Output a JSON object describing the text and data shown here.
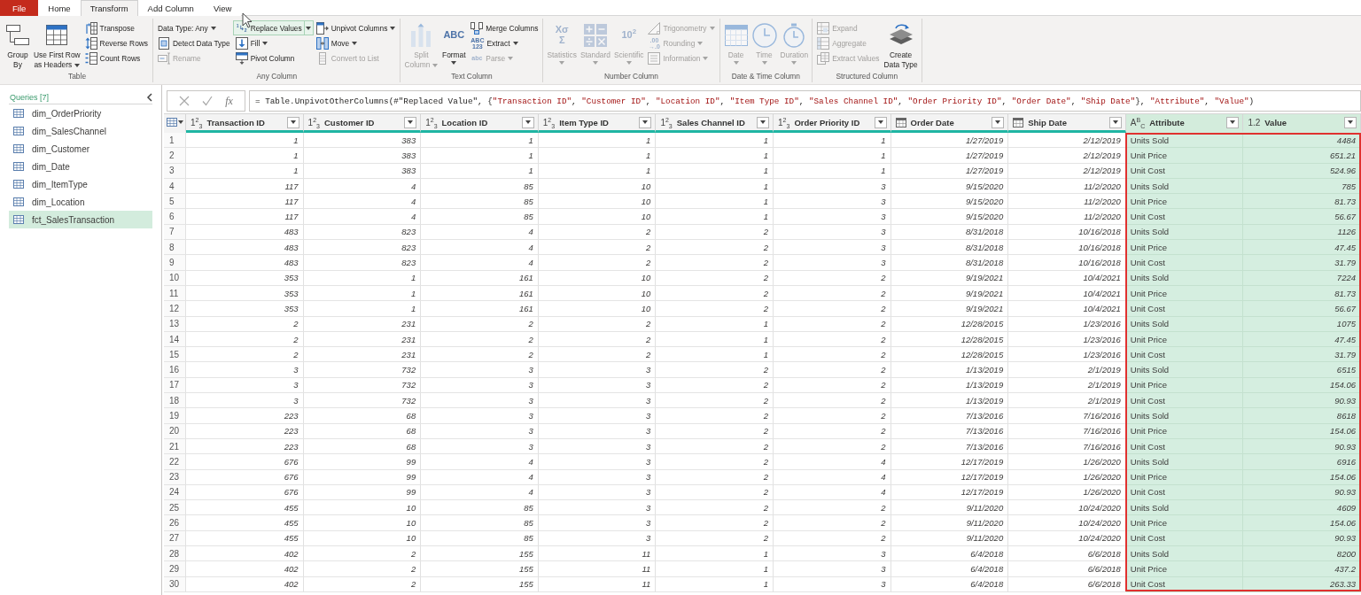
{
  "app_tabs": [
    {
      "label": "File",
      "kind": "file",
      "selected": false
    },
    {
      "label": "Home",
      "kind": "tab",
      "selected": false
    },
    {
      "label": "Transform",
      "kind": "tab",
      "selected": true
    },
    {
      "label": "Add Column",
      "kind": "tab",
      "selected": false
    },
    {
      "label": "View",
      "kind": "tab",
      "selected": false
    }
  ],
  "ribbon_groups": [
    {
      "label": "Table",
      "columns": [
        {
          "kind": "large",
          "items": [
            {
              "label": "Group\nBy",
              "disabled": false
            }
          ]
        },
        {
          "kind": "large",
          "items": [
            {
              "label": "Use First Row\nas Headers",
              "disabled": false,
              "dropdown": true
            }
          ]
        },
        {
          "kind": "small",
          "items": [
            {
              "label": "Transpose",
              "disabled": false
            },
            {
              "label": "Reverse Rows",
              "disabled": false
            },
            {
              "label": "Count Rows",
              "disabled": false
            }
          ]
        }
      ]
    },
    {
      "label": "Any Column",
      "columns": [
        {
          "kind": "small",
          "items": [
            {
              "label": "Data Type: Any",
              "disabled": false,
              "dropdown": true
            },
            {
              "label": "Detect Data Type",
              "disabled": false
            },
            {
              "label": "Rename",
              "disabled": true
            }
          ]
        },
        {
          "kind": "small",
          "items": [
            {
              "label": "Replace Values",
              "glyph": "$^{1}$↳$_{2}$",
              "disabled": false,
              "highlighted": true,
              "dropdown": true,
              "split": true
            },
            {
              "label": "Fill",
              "disabled": false,
              "dropdown": true
            },
            {
              "label": "Pivot Column",
              "disabled": false
            }
          ]
        },
        {
          "kind": "small",
          "items": [
            {
              "label": "Unpivot Columns",
              "disabled": false,
              "dropdown": true
            },
            {
              "label": "Move",
              "disabled": false,
              "dropdown": true
            },
            {
              "label": "Convert to List",
              "disabled": true
            }
          ]
        }
      ]
    },
    {
      "label": "Text Column",
      "columns": [
        {
          "kind": "large",
          "items": [
            {
              "label": "Split\nColumn",
              "disabled": true,
              "dropdown": true
            }
          ]
        },
        {
          "kind": "large",
          "items": [
            {
              "label": "Format",
              "glyph": "ABC",
              "disabled": false,
              "dropdown": true,
              "caret_below": true
            }
          ]
        },
        {
          "kind": "small",
          "items": [
            {
              "label": "Merge Columns",
              "disabled": false
            },
            {
              "label": "Extract",
              "glyph": "ABC\n123",
              "disabled": false,
              "dropdown": true
            },
            {
              "label": "Parse",
              "glyph": "abc",
              "disabled": true,
              "dropdown": true
            }
          ]
        }
      ]
    },
    {
      "label": "Number Column",
      "columns": [
        {
          "kind": "large",
          "items": [
            {
              "label": "Statistics",
              "glyph": "Xσ\nΣ",
              "disabled": true,
              "dropdown": true,
              "caret_below": true
            }
          ]
        },
        {
          "kind": "large",
          "items": [
            {
              "label": "Standard",
              "disabled": true,
              "dropdown": true,
              "caret_below": true
            }
          ]
        },
        {
          "kind": "large",
          "items": [
            {
              "label": "Scientific",
              "glyph": "10$^{2}$",
              "disabled": true,
              "dropdown": true,
              "caret_below": true
            }
          ]
        },
        {
          "kind": "small",
          "items": [
            {
              "label": "Trigonometry",
              "disabled": true,
              "dropdown": true
            },
            {
              "label": "Rounding",
              "glyph": ".00\n→.0",
              "disabled": true,
              "dropdown": true
            },
            {
              "label": "Information",
              "disabled": true,
              "dropdown": true
            }
          ]
        }
      ]
    },
    {
      "label": "Date & Time Column",
      "columns": [
        {
          "kind": "large",
          "items": [
            {
              "label": "Date",
              "disabled": true,
              "dropdown": true,
              "caret_below": true
            }
          ]
        },
        {
          "kind": "large",
          "items": [
            {
              "label": "Time",
              "disabled": true,
              "dropdown": true,
              "caret_below": true
            }
          ]
        },
        {
          "kind": "large",
          "items": [
            {
              "label": "Duration",
              "disabled": true,
              "dropdown": true,
              "caret_below": true
            }
          ]
        }
      ]
    },
    {
      "label": "Structured Column",
      "columns": [
        {
          "kind": "small",
          "items": [
            {
              "label": "Expand",
              "disabled": true
            },
            {
              "label": "Aggregate",
              "disabled": true
            },
            {
              "label": "Extract Values",
              "disabled": true
            }
          ]
        },
        {
          "kind": "large",
          "items": [
            {
              "label": "Create\nData Type",
              "disabled": false
            }
          ]
        }
      ]
    }
  ],
  "sidebar": {
    "title": "Queries [7]",
    "items": [
      {
        "label": "dim_OrderPriority",
        "selected": false
      },
      {
        "label": "dim_SalesChannel",
        "selected": false
      },
      {
        "label": "dim_Customer",
        "selected": false
      },
      {
        "label": "dim_Date",
        "selected": false
      },
      {
        "label": "dim_ItemType",
        "selected": false
      },
      {
        "label": "dim_Location",
        "selected": false
      },
      {
        "label": "fct_SalesTransaction",
        "selected": true
      }
    ]
  },
  "formula_bar": {
    "function_label": "fx",
    "segments": [
      {
        "kind": "code",
        "text": "= Table.UnpivotOtherColumns(#\"Replaced Value\", {"
      },
      {
        "kind": "string",
        "text": "\"Transaction ID\""
      },
      {
        "kind": "code",
        "text": ", "
      },
      {
        "kind": "string",
        "text": "\"Customer ID\""
      },
      {
        "kind": "code",
        "text": ", "
      },
      {
        "kind": "string",
        "text": "\"Location ID\""
      },
      {
        "kind": "code",
        "text": ", "
      },
      {
        "kind": "string",
        "text": "\"Item Type ID\""
      },
      {
        "kind": "code",
        "text": ", "
      },
      {
        "kind": "string",
        "text": "\"Sales Channel ID\""
      },
      {
        "kind": "code",
        "text": ", "
      },
      {
        "kind": "string",
        "text": "\"Order Priority ID\""
      },
      {
        "kind": "code",
        "text": ", "
      },
      {
        "kind": "string",
        "text": "\"Order Date\""
      },
      {
        "kind": "code",
        "text": ", "
      },
      {
        "kind": "string",
        "text": "\"Ship Date\""
      },
      {
        "kind": "code",
        "text": "}, "
      },
      {
        "kind": "string",
        "text": "\"Attribute\""
      },
      {
        "kind": "code",
        "text": ", "
      },
      {
        "kind": "string",
        "text": "\"Value\""
      },
      {
        "kind": "code",
        "text": ")"
      }
    ]
  },
  "table": {
    "columns": [
      {
        "label": "Transaction ID",
        "kind": "number",
        "type_glyph": "1$^{2}$$_{3}$",
        "selected": false,
        "outlined": false
      },
      {
        "label": "Customer ID",
        "kind": "number",
        "type_glyph": "1$^{2}$$_{3}$",
        "selected": false,
        "outlined": false
      },
      {
        "label": "Location ID",
        "kind": "number",
        "type_glyph": "1$^{2}$$_{3}$",
        "selected": false,
        "outlined": false
      },
      {
        "label": "Item Type ID",
        "kind": "number",
        "type_glyph": "1$^{2}$$_{3}$",
        "selected": false,
        "outlined": false
      },
      {
        "label": "Sales Channel ID",
        "kind": "number",
        "type_glyph": "1$^{2}$$_{3}$",
        "selected": false,
        "outlined": false
      },
      {
        "label": "Order Priority ID",
        "kind": "number",
        "type_glyph": "1$^{2}$$_{3}$",
        "selected": false,
        "outlined": false
      },
      {
        "label": "Order Date",
        "kind": "date",
        "selected": false,
        "outlined": false
      },
      {
        "label": "Ship Date",
        "kind": "date",
        "selected": false,
        "outlined": false
      },
      {
        "label": "Attribute",
        "kind": "text",
        "type_glyph": "A$^{B}$$_{C}$",
        "selected": true,
        "outlined": true
      },
      {
        "label": "Value",
        "kind": "decimal",
        "type_glyph": "1.2",
        "selected": true,
        "outlined": true
      }
    ],
    "rows": [
      {
        "number": "1",
        "cells": [
          "1",
          "383",
          "1",
          "1",
          "1",
          "1",
          "1/27/2019",
          "2/12/2019",
          "Units Sold",
          "4484"
        ]
      },
      {
        "number": "2",
        "cells": [
          "1",
          "383",
          "1",
          "1",
          "1",
          "1",
          "1/27/2019",
          "2/12/2019",
          "Unit Price",
          "651.21"
        ]
      },
      {
        "number": "3",
        "cells": [
          "1",
          "383",
          "1",
          "1",
          "1",
          "1",
          "1/27/2019",
          "2/12/2019",
          "Unit Cost",
          "524.96"
        ]
      },
      {
        "number": "4",
        "cells": [
          "117",
          "4",
          "85",
          "10",
          "1",
          "3",
          "9/15/2020",
          "11/2/2020",
          "Units Sold",
          "785"
        ]
      },
      {
        "number": "5",
        "cells": [
          "117",
          "4",
          "85",
          "10",
          "1",
          "3",
          "9/15/2020",
          "11/2/2020",
          "Unit Price",
          "81.73"
        ]
      },
      {
        "number": "6",
        "cells": [
          "117",
          "4",
          "85",
          "10",
          "1",
          "3",
          "9/15/2020",
          "11/2/2020",
          "Unit Cost",
          "56.67"
        ]
      },
      {
        "number": "7",
        "cells": [
          "483",
          "823",
          "4",
          "2",
          "2",
          "3",
          "8/31/2018",
          "10/16/2018",
          "Units Sold",
          "1126"
        ]
      },
      {
        "number": "8",
        "cells": [
          "483",
          "823",
          "4",
          "2",
          "2",
          "3",
          "8/31/2018",
          "10/16/2018",
          "Unit Price",
          "47.45"
        ]
      },
      {
        "number": "9",
        "cells": [
          "483",
          "823",
          "4",
          "2",
          "2",
          "3",
          "8/31/2018",
          "10/16/2018",
          "Unit Cost",
          "31.79"
        ]
      },
      {
        "number": "10",
        "cells": [
          "353",
          "1",
          "161",
          "10",
          "2",
          "2",
          "9/19/2021",
          "10/4/2021",
          "Units Sold",
          "7224"
        ]
      },
      {
        "number": "11",
        "cells": [
          "353",
          "1",
          "161",
          "10",
          "2",
          "2",
          "9/19/2021",
          "10/4/2021",
          "Unit Price",
          "81.73"
        ]
      },
      {
        "number": "12",
        "cells": [
          "353",
          "1",
          "161",
          "10",
          "2",
          "2",
          "9/19/2021",
          "10/4/2021",
          "Unit Cost",
          "56.67"
        ]
      },
      {
        "number": "13",
        "cells": [
          "2",
          "231",
          "2",
          "2",
          "1",
          "2",
          "12/28/2015",
          "1/23/2016",
          "Units Sold",
          "1075"
        ]
      },
      {
        "number": "14",
        "cells": [
          "2",
          "231",
          "2",
          "2",
          "1",
          "2",
          "12/28/2015",
          "1/23/2016",
          "Unit Price",
          "47.45"
        ]
      },
      {
        "number": "15",
        "cells": [
          "2",
          "231",
          "2",
          "2",
          "1",
          "2",
          "12/28/2015",
          "1/23/2016",
          "Unit Cost",
          "31.79"
        ]
      },
      {
        "number": "16",
        "cells": [
          "3",
          "732",
          "3",
          "3",
          "2",
          "2",
          "1/13/2019",
          "2/1/2019",
          "Units Sold",
          "6515"
        ]
      },
      {
        "number": "17",
        "cells": [
          "3",
          "732",
          "3",
          "3",
          "2",
          "2",
          "1/13/2019",
          "2/1/2019",
          "Unit Price",
          "154.06"
        ]
      },
      {
        "number": "18",
        "cells": [
          "3",
          "732",
          "3",
          "3",
          "2",
          "2",
          "1/13/2019",
          "2/1/2019",
          "Unit Cost",
          "90.93"
        ]
      },
      {
        "number": "19",
        "cells": [
          "223",
          "68",
          "3",
          "3",
          "2",
          "2",
          "7/13/2016",
          "7/16/2016",
          "Units Sold",
          "8618"
        ]
      },
      {
        "number": "20",
        "cells": [
          "223",
          "68",
          "3",
          "3",
          "2",
          "2",
          "7/13/2016",
          "7/16/2016",
          "Unit Price",
          "154.06"
        ]
      },
      {
        "number": "21",
        "cells": [
          "223",
          "68",
          "3",
          "3",
          "2",
          "2",
          "7/13/2016",
          "7/16/2016",
          "Unit Cost",
          "90.93"
        ]
      },
      {
        "number": "22",
        "cells": [
          "676",
          "99",
          "4",
          "3",
          "2",
          "4",
          "12/17/2019",
          "1/26/2020",
          "Units Sold",
          "6916"
        ]
      },
      {
        "number": "23",
        "cells": [
          "676",
          "99",
          "4",
          "3",
          "2",
          "4",
          "12/17/2019",
          "1/26/2020",
          "Unit Price",
          "154.06"
        ]
      },
      {
        "number": "24",
        "cells": [
          "676",
          "99",
          "4",
          "3",
          "2",
          "4",
          "12/17/2019",
          "1/26/2020",
          "Unit Cost",
          "90.93"
        ]
      },
      {
        "number": "25",
        "cells": [
          "455",
          "10",
          "85",
          "3",
          "2",
          "2",
          "9/11/2020",
          "10/24/2020",
          "Units Sold",
          "4609"
        ]
      },
      {
        "number": "26",
        "cells": [
          "455",
          "10",
          "85",
          "3",
          "2",
          "2",
          "9/11/2020",
          "10/24/2020",
          "Unit Price",
          "154.06"
        ]
      },
      {
        "number": "27",
        "cells": [
          "455",
          "10",
          "85",
          "3",
          "2",
          "2",
          "9/11/2020",
          "10/24/2020",
          "Unit Cost",
          "90.93"
        ]
      },
      {
        "number": "28",
        "cells": [
          "402",
          "2",
          "155",
          "11",
          "1",
          "3",
          "6/4/2018",
          "6/6/2018",
          "Units Sold",
          "8200"
        ]
      },
      {
        "number": "29",
        "cells": [
          "402",
          "2",
          "155",
          "11",
          "1",
          "3",
          "6/4/2018",
          "6/6/2018",
          "Unit Price",
          "437.2"
        ]
      },
      {
        "number": "30",
        "cells": [
          "402",
          "2",
          "155",
          "11",
          "1",
          "3",
          "6/4/2018",
          "6/6/2018",
          "Unit Cost",
          "263.33"
        ]
      }
    ]
  }
}
